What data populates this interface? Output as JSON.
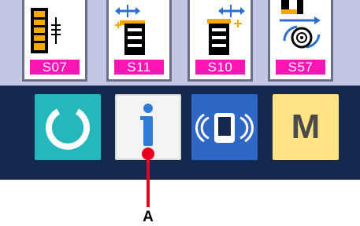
{
  "stitch_buttons": [
    {
      "code": "S07",
      "icon": "stitch-pattern-vertical-icon"
    },
    {
      "code": "S11",
      "icon": "stitch-pattern-width-left-icon"
    },
    {
      "code": "S10",
      "icon": "stitch-pattern-width-right-icon"
    },
    {
      "code": "S57",
      "icon": "stitch-pattern-bobbin-icon"
    }
  ],
  "function_buttons": {
    "reset": {
      "icon": "reset-ring-icon",
      "color": "#26b7bd"
    },
    "info": {
      "icon": "info-icon",
      "color": "#2e7cd6"
    },
    "communication": {
      "icon": "communication-icon",
      "color": "#2f67c4"
    },
    "mode": {
      "label": "M",
      "color": "#ffe385"
    }
  },
  "callout": {
    "label": "A",
    "color": "#e8001e"
  },
  "colors": {
    "top_panel": "#c2c7e3",
    "bottom_panel": "#15284d",
    "badge": "#ff14b4"
  }
}
